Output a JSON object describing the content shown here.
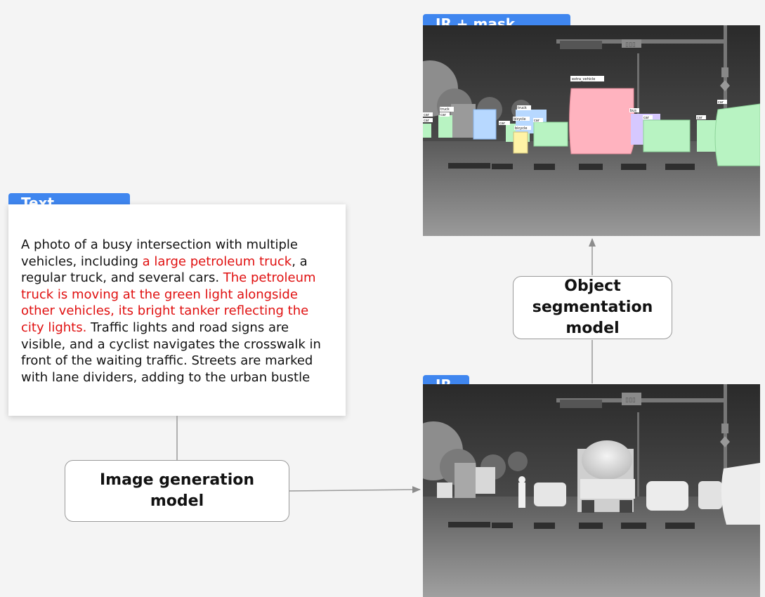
{
  "text_panel": {
    "tag": "Text",
    "segments": [
      {
        "text": "A photo of a busy intersection with multiple vehicles, including ",
        "highlight": false
      },
      {
        "text": "a large petroleum truck",
        "highlight": true
      },
      {
        "text": ", a regular truck, and several cars. ",
        "highlight": false
      },
      {
        "text": "The petroleum truck is moving at the green light alongside other vehicles, its bright tanker reflecting the city lights.",
        "highlight": true
      },
      {
        "text": " Traffic lights and road signs are visible, and a cyclist navigates the crosswalk in front of the waiting traffic. Streets are marked with lane dividers, adding to the urban bustle",
        "highlight": false
      }
    ]
  },
  "generation_model": {
    "line1": "Image generation",
    "line2": "model"
  },
  "segmentation_model": {
    "line1": "Object",
    "line2": "segmentation",
    "line3": "model"
  },
  "ir_image": {
    "tag": "IR",
    "sign": "▯▯▯"
  },
  "ir_mask_image": {
    "tag": "IR + mask anno.",
    "sign": "▯▯▯",
    "labels": [
      "extra_vehicle",
      "truck",
      "car",
      "car",
      "truck",
      "car",
      "car",
      "bicycle",
      "bicycle",
      "car",
      "bus",
      "car",
      "car",
      "car"
    ]
  },
  "colors": {
    "tag_blue": "#3f86ef",
    "highlight_red": "#e01010",
    "mask_pink": "#ffb3bf",
    "mask_green": "#b8f3c2",
    "mask_blue": "#b7d8ff",
    "mask_purple": "#d6c8ff",
    "mask_yellow": "#fff3a6"
  }
}
